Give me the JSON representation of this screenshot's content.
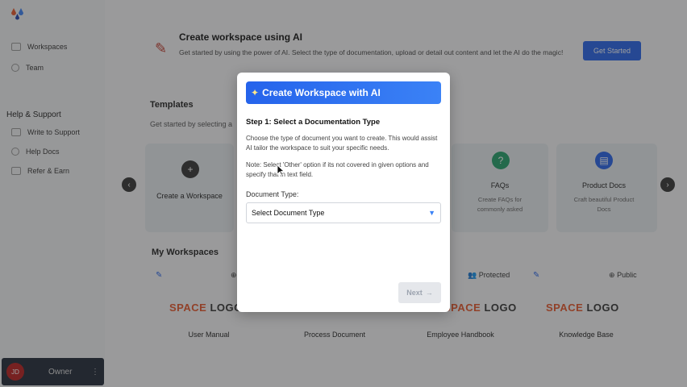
{
  "sidebar": {
    "items": [
      {
        "label": "Workspaces",
        "icon": "folder-icon"
      },
      {
        "label": "Team",
        "icon": "team-icon"
      }
    ],
    "help_title": "Help & Support",
    "help_items": [
      {
        "label": "Write to Support",
        "icon": "support-icon"
      },
      {
        "label": "Help Docs",
        "icon": "docs-icon"
      },
      {
        "label": "Refer & Earn",
        "icon": "gift-icon"
      }
    ],
    "user": {
      "initials": "JD",
      "role": "Owner",
      "menu": "⋮"
    }
  },
  "banner": {
    "title": "Create workspace using AI",
    "description": "Get started by using the power of AI. Select the type of documentation, upload or detail out content and let the AI do the magic!",
    "button": "Get Started"
  },
  "templates": {
    "title": "Templates",
    "subtitle": "Get started by selecting a",
    "create_label": "Create a Workspace",
    "cards": [
      {
        "name": "FAQs",
        "desc": "Create FAQs for commonly asked",
        "color": "#22a06b"
      },
      {
        "name": "Product Docs",
        "desc": "Craft beautiful Product Docs",
        "color": "#2563eb"
      }
    ]
  },
  "my_workspaces": {
    "title": "My Workspaces",
    "logo_space": "SPACE",
    "logo_word": "LOGO",
    "badges": [
      "Protected",
      "Public"
    ],
    "items": [
      "User Manual",
      "Process Document",
      "Employee Handbook",
      "Knowledge Base"
    ]
  },
  "modal": {
    "title": "Create Workspace with AI",
    "step_title": "Step 1: Select a Documentation Type",
    "step_desc": "Choose the type of document you want to create. This would assist AI tailor the workspace to suit your specific needs.",
    "note": "Note: Select 'Other' option if its not covered in given options and specify that in text field.",
    "field_label": "Document Type:",
    "select_value": "Select Document Type",
    "next_label": "Next"
  },
  "colors": {
    "accent": "#2563eb",
    "brand_red": "#e8572a"
  }
}
